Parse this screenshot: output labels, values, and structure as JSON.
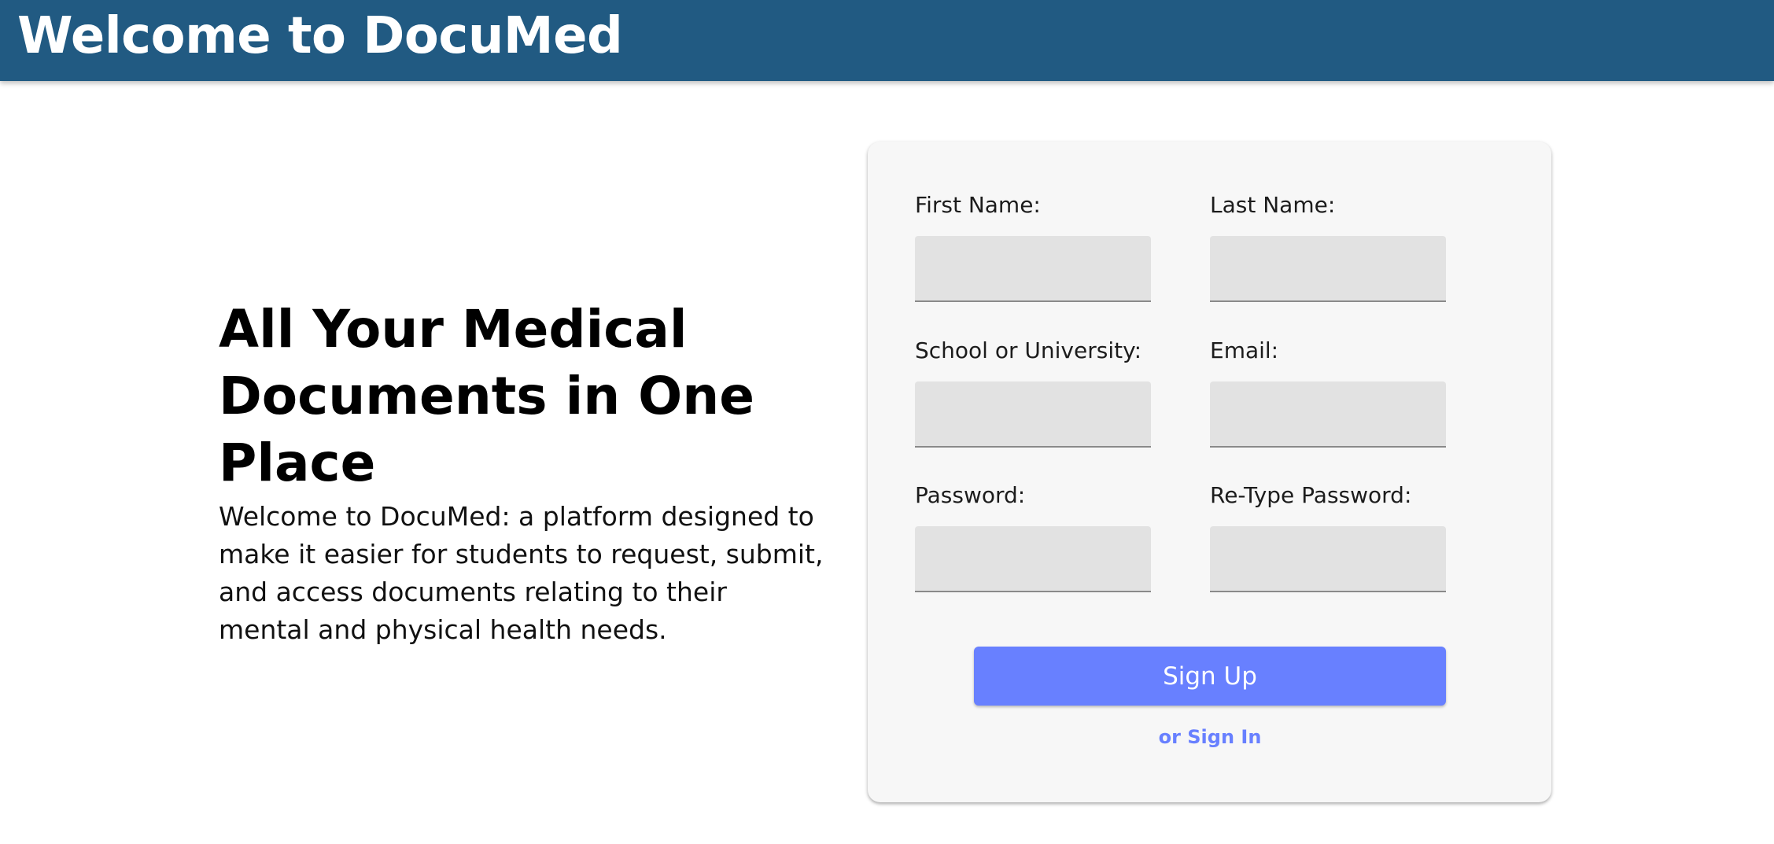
{
  "header": {
    "title": "Welcome to DocuMed"
  },
  "hero": {
    "title": "All Your Medical Documents in One Place",
    "description": "Welcome to DocuMed: a platform designed to make it easier for students to request, submit, and access documents relating to their mental and physical health needs."
  },
  "form": {
    "first_name": {
      "label": "First Name:",
      "value": ""
    },
    "last_name": {
      "label": "Last Name:",
      "value": ""
    },
    "school": {
      "label": "School or University:",
      "value": ""
    },
    "email": {
      "label": "Email:",
      "value": ""
    },
    "password": {
      "label": "Password:",
      "value": ""
    },
    "retype_password": {
      "label": "Re-Type Password:",
      "value": ""
    },
    "signup_label": "Sign Up",
    "signin_label": "or Sign In"
  },
  "colors": {
    "header_bg": "#215a82",
    "button_bg": "#6880ff",
    "card_bg": "#f7f7f7",
    "input_bg": "#e2e2e2"
  }
}
